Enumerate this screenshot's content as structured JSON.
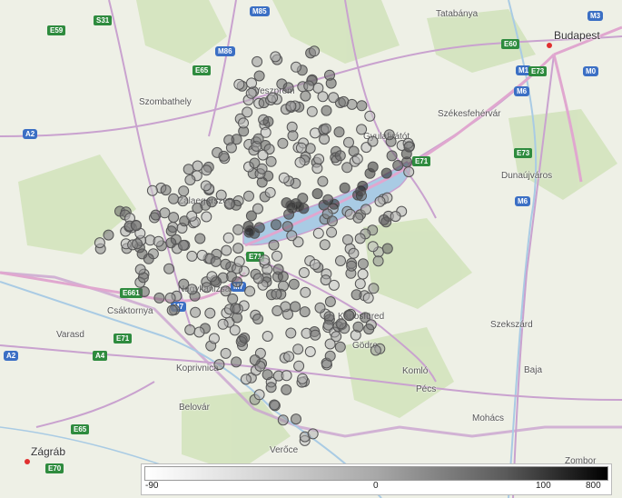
{
  "map": {
    "places": [
      {
        "name": "Tatabánya",
        "key": "tatabanya"
      },
      {
        "name": "Budapest",
        "key": "budapest"
      },
      {
        "name": "Szombathely",
        "key": "szombathely"
      },
      {
        "name": "Székesfehérvár",
        "key": "szekesfehervar"
      },
      {
        "name": "Dunaújváros",
        "key": "dunaujvaros"
      },
      {
        "name": "Veszprém",
        "key": "veszprem"
      },
      {
        "name": "Zalaegerszeg",
        "key": "zalaegerszeg"
      },
      {
        "name": "Nagykanizsa",
        "key": "nagykanizsa"
      },
      {
        "name": "Csáktornya",
        "key": "csaktornya"
      },
      {
        "name": "Varasd",
        "key": "varasd"
      },
      {
        "name": "Kaposfüred",
        "key": "kaposfured"
      },
      {
        "name": "Szekszárd",
        "key": "szekszard"
      },
      {
        "name": "Gödre",
        "key": "godre"
      },
      {
        "name": "Komló",
        "key": "komlo"
      },
      {
        "name": "Pécs",
        "key": "pecs"
      },
      {
        "name": "Baja",
        "key": "baja"
      },
      {
        "name": "Mohács",
        "key": "mohacs"
      },
      {
        "name": "Koprivnica",
        "key": "koprivnica"
      },
      {
        "name": "Belovár",
        "key": "belovar"
      },
      {
        "name": "Verőce",
        "key": "veroce"
      },
      {
        "name": "Zágráb",
        "key": "zagrab"
      },
      {
        "name": "Zombor",
        "key": "zombor"
      },
      {
        "name": "Gyulafirátót",
        "key": "gyulafiratot"
      }
    ],
    "roads": [
      "S31",
      "E59",
      "M85",
      "M86",
      "E65",
      "A2",
      "E60",
      "M1",
      "M3",
      "M0",
      "E73",
      "M6",
      "E71",
      "M7",
      "A4",
      "E70",
      "E661",
      "A2b"
    ],
    "road_labels": {
      "S31": "S31",
      "E59": "E59",
      "M85": "M85",
      "M86": "M86",
      "E65": "E65",
      "A2": "A2",
      "E60": "E60",
      "M1": "M1",
      "M3": "M3",
      "M0": "M0",
      "E73": "E73",
      "M6": "M6",
      "E71": "E71",
      "M7": "M7",
      "A4": "A4",
      "E70": "E70",
      "E661": "E661",
      "A2b": "A2",
      "E71b": "E71",
      "E65b": "E65",
      "M6b": "M6",
      "E71c": "E71",
      "M7b": "M7"
    }
  },
  "legend": {
    "min_label": "-90",
    "zero_label": "0",
    "mid_label": "100",
    "max_label": "800"
  },
  "colors": {
    "water": "#a9cbe4",
    "forest": "#cfe0b8",
    "major_road": "#c9a2cf",
    "motorway": "#e0a7cf",
    "point_light": "#e8e8e8",
    "point_dark": "#111111"
  }
}
